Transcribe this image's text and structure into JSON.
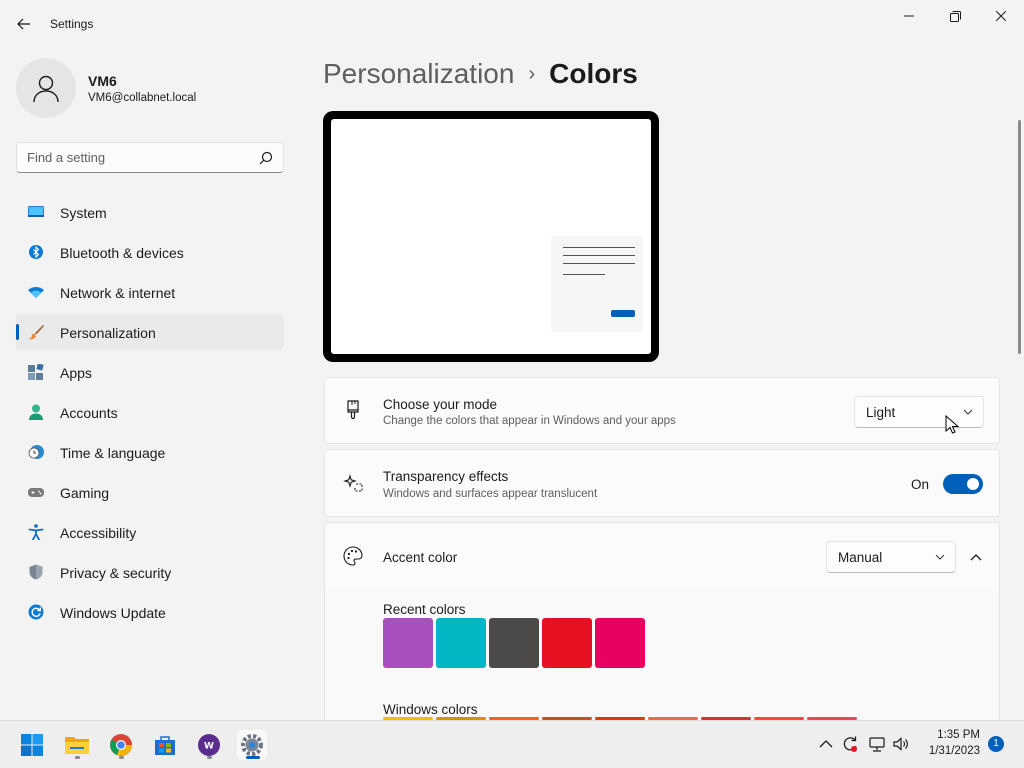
{
  "window": {
    "title": "Settings"
  },
  "profile": {
    "name": "VM6",
    "email": "VM6@collabnet.local"
  },
  "search": {
    "placeholder": "Find a setting"
  },
  "sidebar": {
    "items": [
      {
        "label": "System",
        "icon": "monitor-icon"
      },
      {
        "label": "Bluetooth & devices",
        "icon": "bluetooth-icon"
      },
      {
        "label": "Network & internet",
        "icon": "wifi-icon"
      },
      {
        "label": "Personalization",
        "icon": "paintbrush-icon",
        "active": true
      },
      {
        "label": "Apps",
        "icon": "apps-icon"
      },
      {
        "label": "Accounts",
        "icon": "person-icon"
      },
      {
        "label": "Time & language",
        "icon": "clock-globe-icon"
      },
      {
        "label": "Gaming",
        "icon": "gamepad-icon"
      },
      {
        "label": "Accessibility",
        "icon": "accessibility-icon"
      },
      {
        "label": "Privacy & security",
        "icon": "shield-icon"
      },
      {
        "label": "Windows Update",
        "icon": "refresh-icon"
      }
    ]
  },
  "header": {
    "parent": "Personalization",
    "separator": "›",
    "current": "Colors"
  },
  "mode_card": {
    "title": "Choose your mode",
    "subtitle": "Change the colors that appear in Windows and your apps",
    "value": "Light"
  },
  "transparency_card": {
    "title": "Transparency effects",
    "subtitle": "Windows and surfaces appear translucent",
    "state_label": "On"
  },
  "accent_card": {
    "title": "Accent color",
    "value": "Manual",
    "recent_label": "Recent colors",
    "recent_colors": [
      "#a94fc0",
      "#00b7c3",
      "#4c4a48",
      "#e81123",
      "#ea005e"
    ],
    "windows_label": "Windows colors",
    "windows_colors": [
      "#ffb900",
      "#e08c00",
      "#f7630c",
      "#ca5010",
      "#da3b01",
      "#ef6950",
      "#d13438",
      "#ff4343",
      "#e74856"
    ]
  },
  "colors": {
    "accent": "#005fb8",
    "background": "#f3f3f3",
    "card": "#fbfbfb"
  },
  "taskbar": {
    "apps": [
      "windows-start-icon",
      "file-explorer-icon",
      "chrome-icon",
      "store-icon",
      "webex-icon",
      "settings-icon"
    ],
    "time": "1:35 PM",
    "date": "1/31/2023",
    "notification_count": "1"
  }
}
